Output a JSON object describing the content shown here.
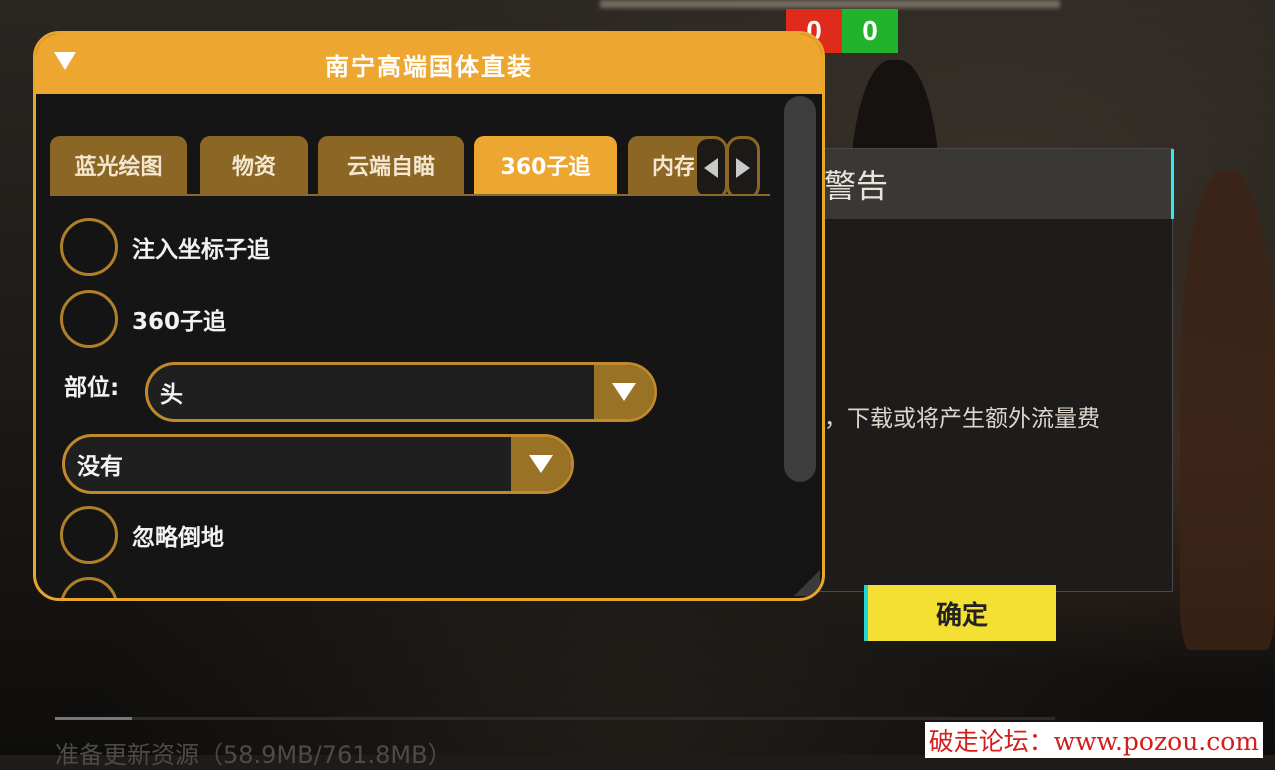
{
  "scores": {
    "red": "0",
    "green": "0"
  },
  "panel": {
    "title": "南宁高端国体直装",
    "tabs": [
      {
        "label": "蓝光绘图",
        "active": false
      },
      {
        "label": "物资",
        "active": false
      },
      {
        "label": "云端自瞄",
        "active": false
      },
      {
        "label": "360子追",
        "active": true
      },
      {
        "label": "内存",
        "active": false
      }
    ],
    "options": {
      "inject_tracking": "注入坐标子追",
      "tracking_360": "360子追",
      "ignore_downed": "忽略倒地"
    },
    "part_label": "部位:",
    "part_value": "头",
    "second_select_value": "没有"
  },
  "warning": {
    "title": "警告",
    "message": "，下载或将产生额外流量费",
    "confirm": "确定"
  },
  "update": {
    "text": "准备更新资源（58.9MB/761.8MB）",
    "progress": 0.077
  },
  "watermark": "破走论坛：www.pozou.com",
  "colors": {
    "accent": "#eda731",
    "tab": "#8b6624",
    "confirm": "#f3e032"
  }
}
